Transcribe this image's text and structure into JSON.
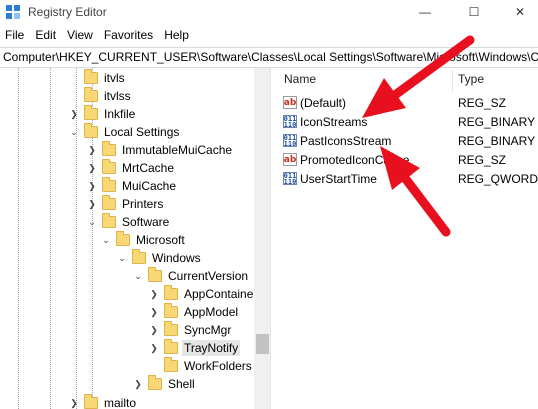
{
  "window": {
    "title": "Registry Editor",
    "minimize_glyph": "—",
    "maximize_glyph": "☐",
    "close_glyph": "✕"
  },
  "menu": [
    "File",
    "Edit",
    "View",
    "Favorites",
    "Help"
  ],
  "address": "Computer\\HKEY_CURRENT_USER\\Software\\Classes\\Local Settings\\Software\\Microsoft\\Windows\\Cur",
  "tree": [
    {
      "label": "itvls",
      "expanded": null
    },
    {
      "label": "itvlss",
      "expanded": null
    },
    {
      "label": "Inkfile",
      "expanded": false
    },
    {
      "label": "Local Settings",
      "expanded": true
    },
    {
      "label": "ImmutableMuiCache",
      "expanded": false
    },
    {
      "label": "MrtCache",
      "expanded": false
    },
    {
      "label": "MuiCache",
      "expanded": false
    },
    {
      "label": "Printers",
      "expanded": false
    },
    {
      "label": "Software",
      "expanded": true
    },
    {
      "label": "Microsoft",
      "expanded": true
    },
    {
      "label": "Windows",
      "expanded": true
    },
    {
      "label": "CurrentVersion",
      "expanded": true
    },
    {
      "label": "AppContainer",
      "expanded": false
    },
    {
      "label": "AppModel",
      "expanded": false
    },
    {
      "label": "SyncMgr",
      "expanded": false
    },
    {
      "label": "TrayNotify",
      "expanded": false,
      "selected": true
    },
    {
      "label": "WorkFolders",
      "expanded": null
    },
    {
      "label": "Shell",
      "expanded": false
    },
    {
      "label": "mailto",
      "expanded": false
    }
  ],
  "columns": {
    "name": "Name",
    "type": "Type"
  },
  "values": [
    {
      "name": "(Default)",
      "type": "REG_SZ",
      "icon": "string-value-icon"
    },
    {
      "name": "IconStreams",
      "type": "REG_BINARY",
      "icon": "binary-value-icon"
    },
    {
      "name": "PastIconsStream",
      "type": "REG_BINARY",
      "icon": "binary-value-icon"
    },
    {
      "name": "PromotedIconCache",
      "type": "REG_SZ",
      "icon": "string-value-icon"
    },
    {
      "name": "UserStartTime",
      "type": "REG_QWORD",
      "icon": "binary-value-icon"
    }
  ],
  "colors": {
    "arrow": "#e8101e",
    "folder": "#f8d775",
    "selection": "#e5e5e5"
  }
}
